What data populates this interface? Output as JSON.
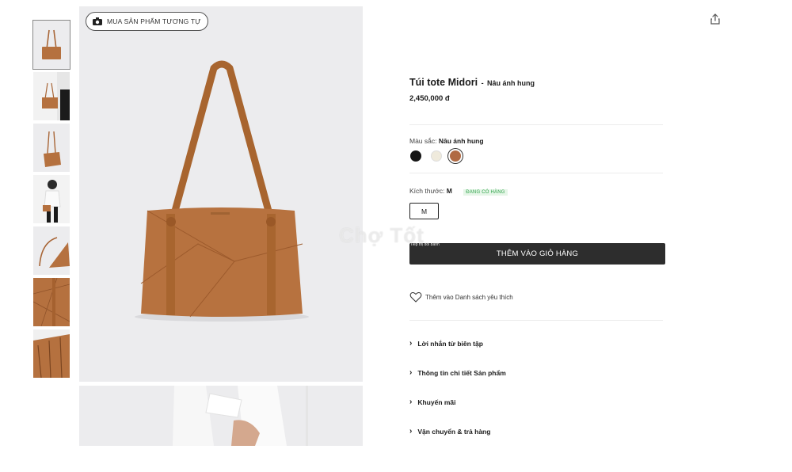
{
  "gallery": {
    "similar_button_label": "MUA SẢN PHẨM TƯƠNG TỰ",
    "thumbnail_count": 7
  },
  "product": {
    "title": "Túi tote Midori",
    "separator": "-",
    "variant": "Nâu ánh hung",
    "price": "2,450,000 đ"
  },
  "color": {
    "label": "Màu sắc:",
    "value": "Nâu ánh hung",
    "swatches": [
      "#151515",
      "#efeadc",
      "#b06a43"
    ],
    "selected_index": 2
  },
  "size": {
    "label": "Kích thước:",
    "value": "M",
    "stock_badge": "ĐANG CÓ HÀNG",
    "option": "M"
  },
  "cart": {
    "add_label": "THÊM VÀO GIỎ HÀNG"
  },
  "wishlist": {
    "label": "Thêm vào Danh sách yêu thích"
  },
  "accordion": [
    {
      "label": "Lời nhắn từ biên tập"
    },
    {
      "label": "Thông tin chi tiết Sản phẩm"
    },
    {
      "label": "Khuyến mãi"
    },
    {
      "label": "Vận chuyển & trả hàng"
    }
  ],
  "watermark": {
    "text": "Chợ Tốt",
    "sub": "Tiếp thị đổi bánh"
  },
  "colors": {
    "button_bg": "#2d2d2d",
    "bag_brown": "#b5713f",
    "stock_green": "#2fa34a"
  }
}
